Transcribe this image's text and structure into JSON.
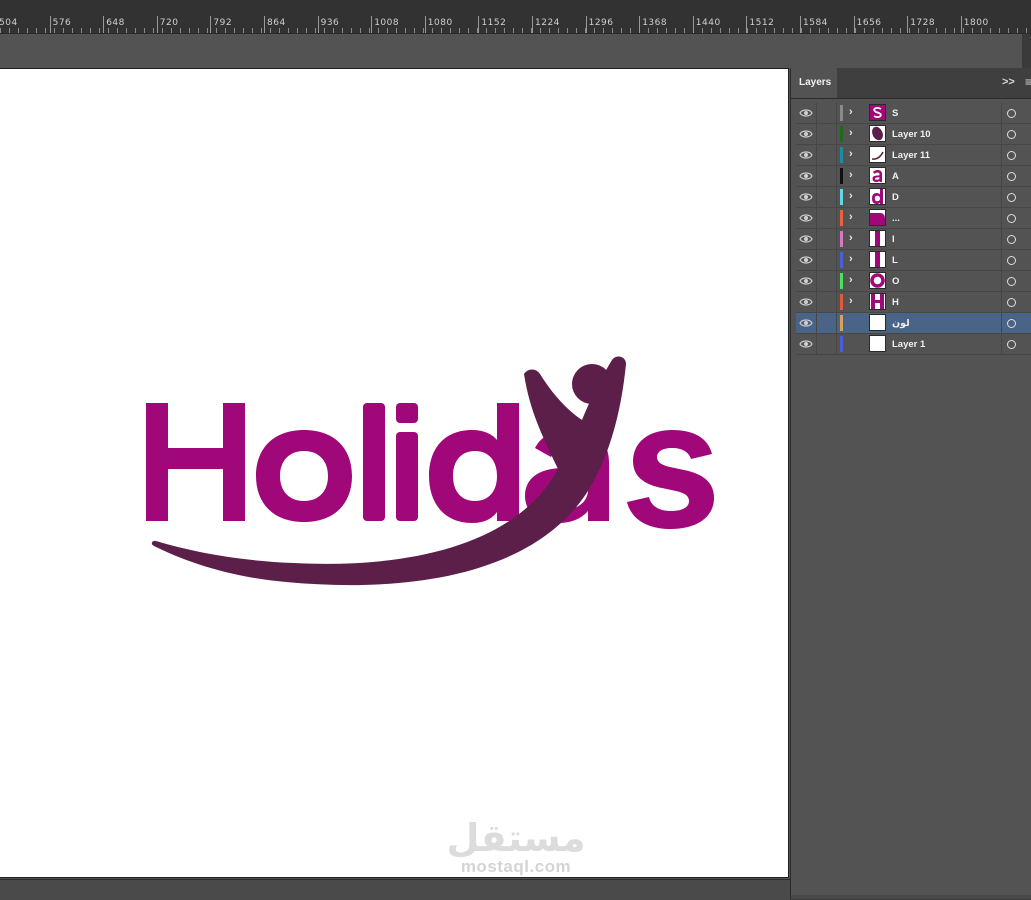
{
  "ruler": {
    "labels": [
      "504",
      "576",
      "648",
      "720",
      "792",
      "864",
      "936",
      "1008",
      "1080",
      "1152",
      "1224",
      "1296",
      "1368",
      "1440",
      "1512",
      "1584",
      "1656",
      "1728",
      "1800"
    ]
  },
  "logo": {
    "brand_color": "#a0087a",
    "figure_color": "#5c1f4a"
  },
  "layers_panel": {
    "tab_label": "Layers",
    "collapse_glyph": ">>",
    "menu_glyph": "≡",
    "layers": [
      {
        "name": "S",
        "swatch": "#8a8a8a",
        "has_children": true,
        "thumb": "S",
        "selected": false
      },
      {
        "name": "Layer 10",
        "swatch": "#1b6b1b",
        "has_children": true,
        "thumb": "shape-dark",
        "selected": false
      },
      {
        "name": "Layer 11",
        "swatch": "#1f8aa0",
        "has_children": true,
        "thumb": "curve",
        "selected": false
      },
      {
        "name": "A",
        "swatch": "#111111",
        "has_children": true,
        "thumb": "a",
        "selected": false
      },
      {
        "name": "D",
        "swatch": "#5fd7e8",
        "has_children": true,
        "thumb": "d",
        "selected": false
      },
      {
        "name": "...",
        "swatch": "#e8603c",
        "has_children": true,
        "thumb": "shape-brand",
        "selected": false
      },
      {
        "name": "I",
        "swatch": "#d47ac2",
        "has_children": true,
        "thumb": "i",
        "selected": false
      },
      {
        "name": "L",
        "swatch": "#4a5fd8",
        "has_children": true,
        "thumb": "l",
        "selected": false
      },
      {
        "name": "O",
        "swatch": "#4fe05a",
        "has_children": true,
        "thumb": "o",
        "selected": false
      },
      {
        "name": "H",
        "swatch": "#e05a3c",
        "has_children": true,
        "thumb": "H",
        "selected": false
      },
      {
        "name": "لون",
        "swatch": "#d8a060",
        "has_children": false,
        "thumb": "blank",
        "selected": true
      },
      {
        "name": "Layer 1",
        "swatch": "#4a5fd8",
        "has_children": false,
        "thumb": "blank",
        "selected": false
      }
    ]
  },
  "watermark": {
    "arabic": "مستقل",
    "latin": "mostaql.com"
  }
}
